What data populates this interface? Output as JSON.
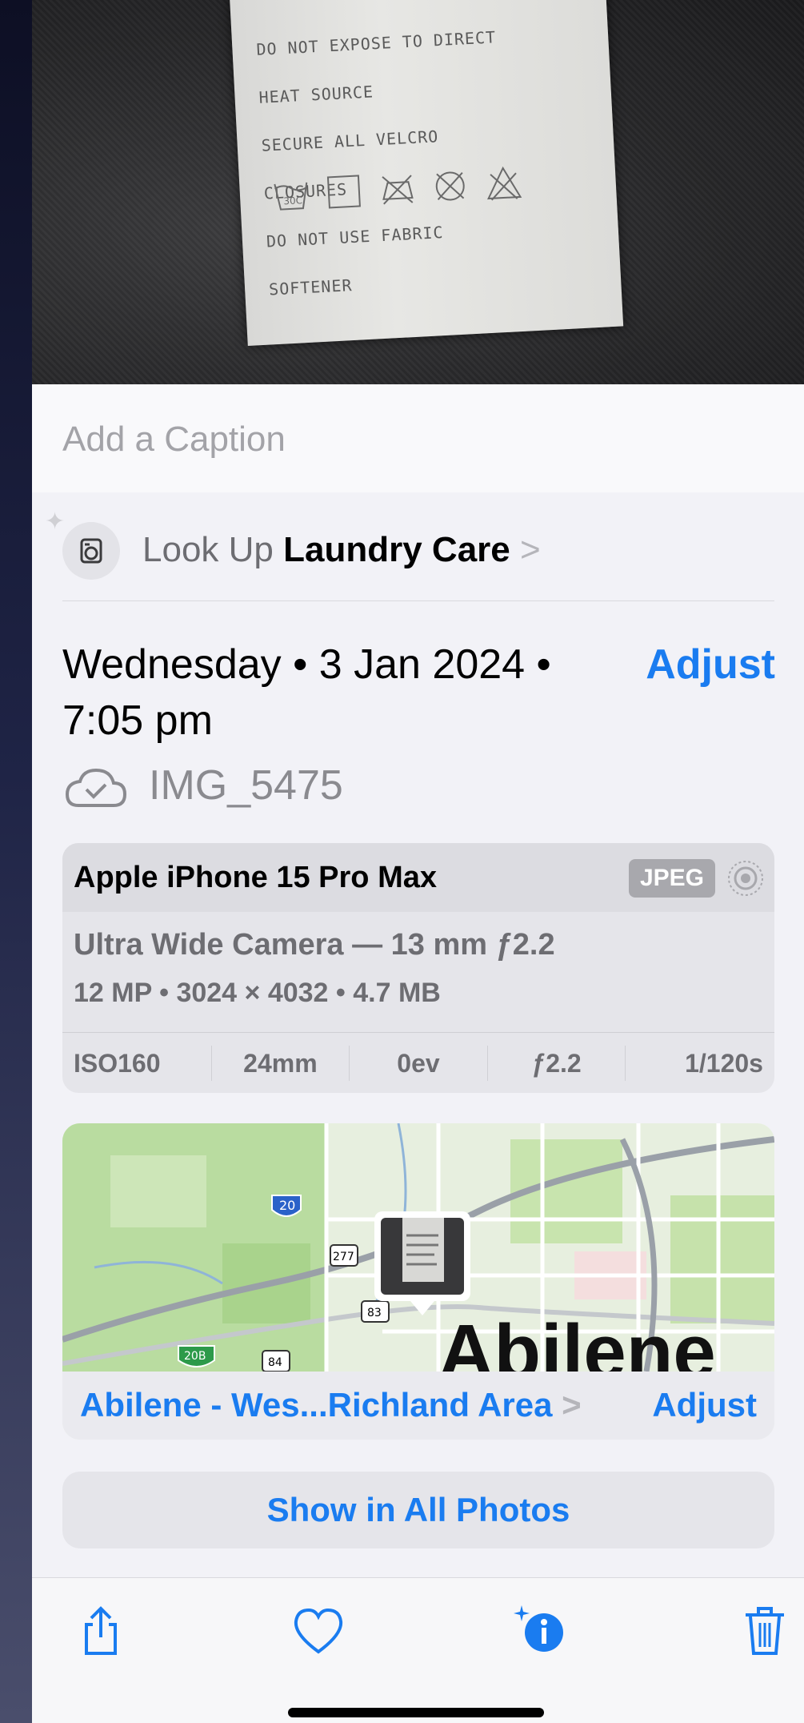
{
  "photo": {
    "label_lines": [
      "DO NOT EXPOSE TO DIRECT",
      "HEAT SOURCE",
      "SECURE ALL VELCRO",
      "CLOSURES",
      "DO NOT USE FABRIC",
      "SOFTENER"
    ],
    "wash_temp": "30C"
  },
  "caption": {
    "placeholder": "Add a Caption"
  },
  "lookup": {
    "prefix": "Look Up",
    "subject": "Laundry Care",
    "chevron": ">"
  },
  "date": {
    "line1": "Wednesday • 3 Jan 2024 •",
    "line2": "7:05 pm",
    "adjust_label": "Adjust"
  },
  "file": {
    "name": "IMG_5475",
    "icon": "icloud-check-icon"
  },
  "camera": {
    "device": "Apple iPhone 15 Pro Max",
    "format_badge": "JPEG",
    "lens": "Ultra Wide Camera — 13 mm ƒ2.2",
    "specs": "12 MP • 3024 × 4032 • 4.7 MB",
    "exif": [
      "ISO160",
      "24mm",
      "0ev",
      "ƒ2.2",
      "1/120s"
    ]
  },
  "map": {
    "city_label": "Abilene",
    "shields": [
      "20",
      "277",
      "83",
      "84",
      "20B"
    ],
    "location": "Abilene - Wes...Richland Area",
    "location_chevron": ">",
    "adjust_label": "Adjust"
  },
  "show_all_label": "Show in All Photos",
  "toolbar": {
    "icons": [
      "share-icon",
      "heart-icon",
      "info-sparkle-icon",
      "trash-icon"
    ]
  },
  "colors": {
    "accent": "#1a7cf0",
    "background": "#f2f2f7"
  }
}
